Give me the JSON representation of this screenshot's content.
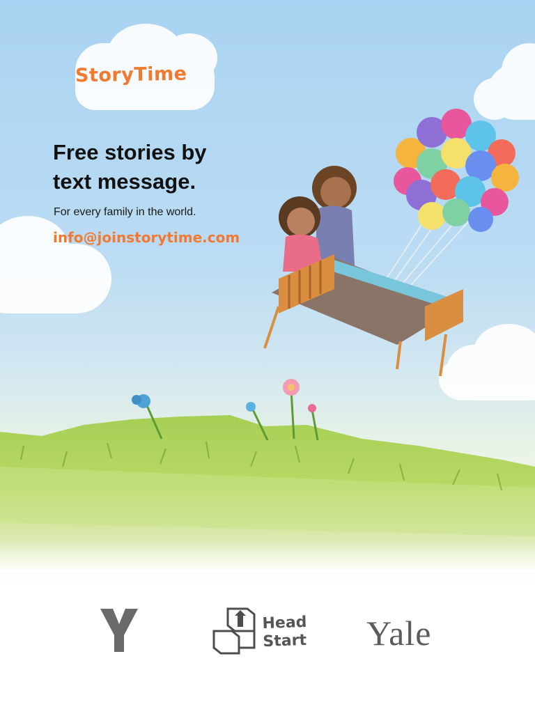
{
  "brand": {
    "name": "StoryTime",
    "color": "#f07a32"
  },
  "hero": {
    "headline_line1": "Free stories by",
    "headline_line2": "text message.",
    "tagline": "For every family in the world.",
    "email": "info@joinstorytime.com"
  },
  "illustration": {
    "subject": "parent and child flying on a bed lifted by balloons",
    "balloon_colors": [
      "#e8579c",
      "#f5b43d",
      "#5ec3e8",
      "#8e6fd6",
      "#f26b5b",
      "#7fd0a3",
      "#f5e06b",
      "#6a8ef0"
    ]
  },
  "partners": {
    "ymca_label": "YMCA",
    "headstart_line1": "Head",
    "headstart_line2": "Start",
    "yale_label": "Yale"
  },
  "colors": {
    "sky": "#a9d3f2",
    "grass": "#9cc84a",
    "text_dark": "#111111",
    "logo_gray": "#5b5b5b"
  }
}
